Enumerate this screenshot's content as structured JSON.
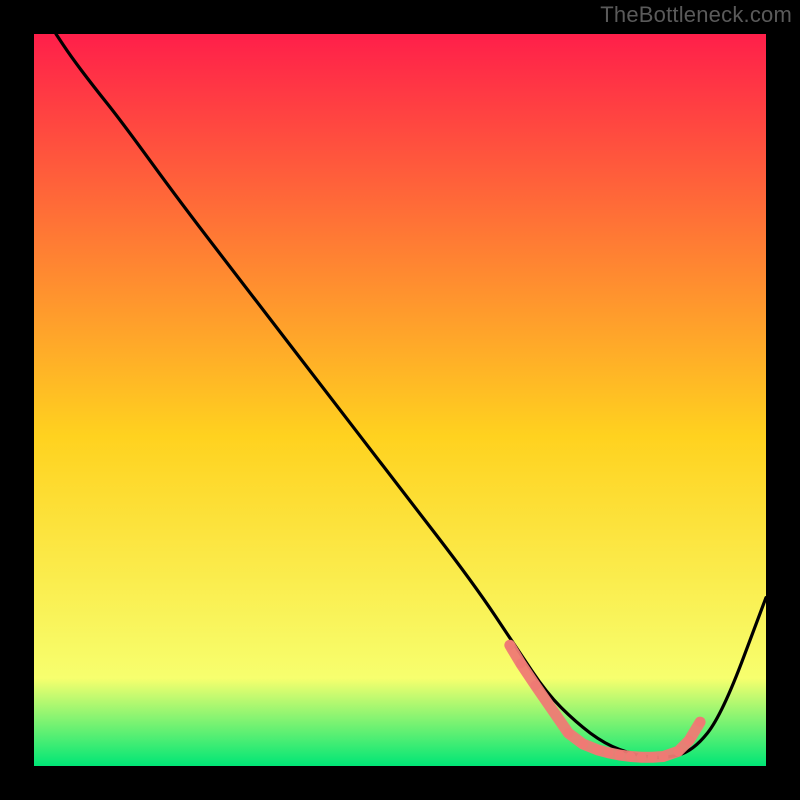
{
  "watermark": "TheBottleneck.com",
  "chart_data": {
    "type": "line",
    "title": "",
    "xlabel": "",
    "ylabel": "",
    "xlim": [
      0,
      100
    ],
    "ylim": [
      0,
      100
    ],
    "grid": false,
    "legend": false,
    "gradient": {
      "top_color": "#ff1f4a",
      "mid_color": "#ffd21f",
      "near_bottom_color": "#f7ff6e",
      "bottom_color": "#00e676"
    },
    "series": [
      {
        "name": "curve",
        "stroke": "#000000",
        "x": [
          3,
          5,
          8,
          12,
          20,
          30,
          40,
          50,
          60,
          66,
          70,
          74,
          78,
          82,
          86,
          90,
          94,
          100
        ],
        "y": [
          100,
          97,
          93,
          88,
          77,
          64,
          51,
          38,
          25,
          16,
          10,
          6,
          3,
          1.5,
          1,
          2,
          7,
          23
        ]
      }
    ],
    "highlight_points": {
      "color": "#ef7a74",
      "radius_small": 5,
      "x": [
        65,
        66.5,
        68.5,
        73,
        75,
        77,
        78.5,
        80,
        81.5,
        83,
        84.5,
        86,
        88,
        89.5,
        91
      ],
      "y": [
        16.5,
        14,
        11,
        4.5,
        3,
        2.2,
        1.8,
        1.5,
        1.3,
        1.2,
        1.2,
        1.3,
        2,
        3.5,
        6
      ]
    }
  }
}
